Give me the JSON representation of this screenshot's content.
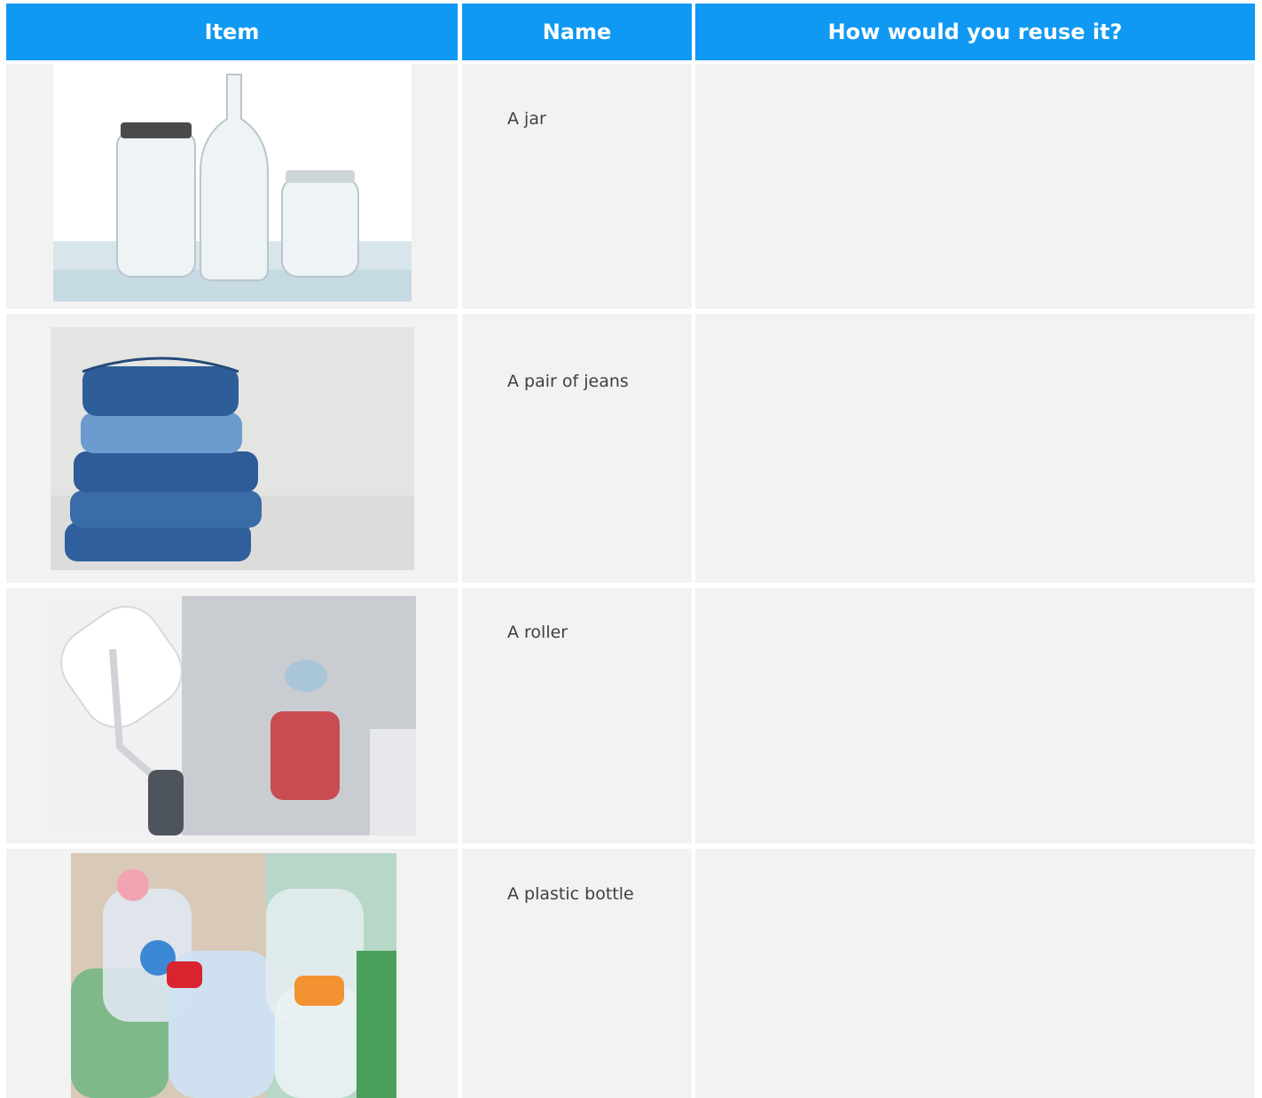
{
  "table": {
    "headers": [
      "Item",
      "Name",
      "How would you reuse it?"
    ],
    "rows": [
      {
        "image": "jars-photo",
        "name": "A jar",
        "reuse": ""
      },
      {
        "image": "jeans-photo",
        "name": "A pair of jeans",
        "reuse": ""
      },
      {
        "image": "roller-photo",
        "name": "A roller",
        "reuse": ""
      },
      {
        "image": "plastic-bottles-photo",
        "name": "A plastic bottle",
        "reuse": ""
      }
    ]
  },
  "colors": {
    "header": "#0f99f3",
    "cell": "#f2f2f2",
    "text": "#3f3f3f"
  }
}
